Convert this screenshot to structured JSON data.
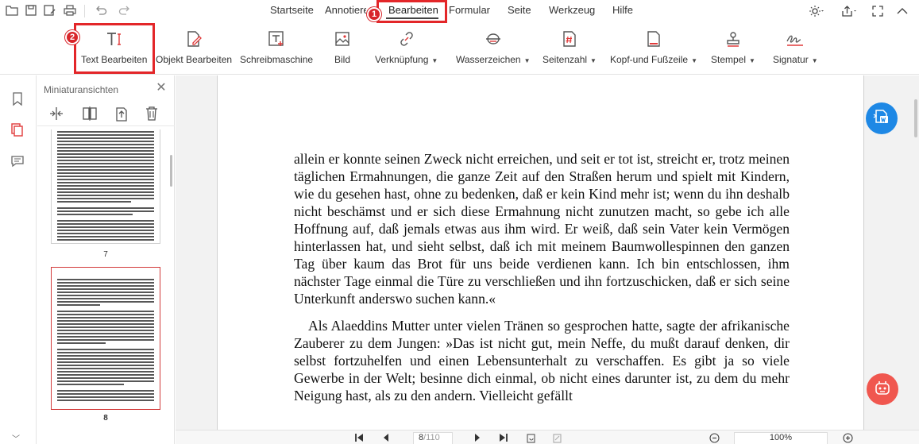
{
  "menu": {
    "tabs": [
      "Startseite",
      "Annotieren",
      "Bearbeiten",
      "Formular",
      "Seite",
      "Werkzeug",
      "Hilfe"
    ],
    "active_tab": "Bearbeiten"
  },
  "ribbon": {
    "text_edit": "Text Bearbeiten",
    "object_edit": "Objekt Bearbeiten",
    "typewriter": "Schreibmaschine",
    "image": "Bild",
    "link": "Verknüpfung",
    "watermark": "Wasserzeichen",
    "page_number": "Seitenzahl",
    "header_footer": "Kopf-und Fußzeile",
    "stamp": "Stempel",
    "signature": "Signatur"
  },
  "badges": {
    "one": "1",
    "two": "2"
  },
  "thumbnails": {
    "title": "Miniaturansichten",
    "pages": [
      {
        "number": "7"
      },
      {
        "number": "8"
      }
    ]
  },
  "document": {
    "paragraphs": [
      "allein er konnte seinen Zweck nicht erreichen, und seit er tot ist, streicht er, trotz meinen täglichen Ermahnungen, die ganze Zeit auf den Straßen herum und spielt mit Kindern, wie du gesehen hast, ohne zu bedenken, daß er kein Kind mehr ist; wenn du ihn deshalb nicht beschämst und er sich diese Ermahnung nicht zunutzen macht, so gebe ich alle Hoffnung auf, daß jemals etwas aus ihm wird. Er weiß, daß sein Vater kein Vermögen hinterlassen hat, und sieht selbst, daß ich mit meinem Baumwollespinnen den ganzen Tag über kaum das Brot für uns beide verdienen kann. Ich bin entschlossen, ihm nächster Tage einmal die Türe zu verschließen und ihn fortzuschicken, daß er sich seine Unterkunft anderswo suchen kann.«",
      "Als Alaeddins Mutter unter vielen Tränen so gesprochen hatte, sagte der afrikanische Zauberer zu dem Jungen: »Das ist nicht gut, mein Neffe, du mußt darauf denken, dir selbst fortzuhelfen und einen Lebensunterhalt zu verschaffen. Es gibt ja so viele Gewerbe in der Welt; besinne dich einmal, ob nicht eines darunter ist, zu dem du mehr Neigung hast, als zu den andern. Vielleicht gefällt"
    ]
  },
  "status": {
    "current_page": "8",
    "total_pages": "/110",
    "zoom": "100%"
  },
  "colors": {
    "highlight": "#e32629",
    "convert_button": "#1e88e5",
    "assistant_button": "#f0574f"
  }
}
